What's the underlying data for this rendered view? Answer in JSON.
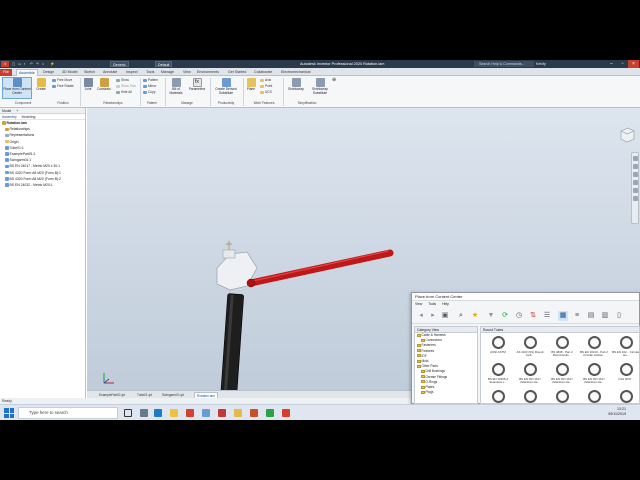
{
  "titlebar": {
    "logo": "I",
    "workspace": "Generic",
    "appearance": "Default",
    "title": "Autodesk Inventor Professional 2020   Rotation.iam",
    "search_placeholder": "Search Help & Commands...",
    "user": "Kelvfy"
  },
  "tabs": [
    "File",
    "Assemble",
    "Design",
    "3D Model",
    "Sketch",
    "Annotate",
    "Inspect",
    "Tools",
    "Manage",
    "View",
    "Environments",
    "Get Started",
    "Collaborate",
    "Electromechanical"
  ],
  "ribbon": {
    "place_label": "Place from Content Center",
    "create_label": "Create",
    "free_move": "Free Move",
    "free_rotate": "Free Rotate",
    "joint": "Joint",
    "constrain": "Constrain",
    "show": "Show",
    "show_sick": "Show Sick",
    "hide_all": "Hide All",
    "pattern": "Pattern",
    "mirror": "Mirror",
    "copy": "Copy",
    "bom": "Bill of Materials",
    "parameters": "Parameters",
    "create_substitute": "Create Derived Substitute",
    "plane": "Plane",
    "axis": "Axis",
    "point": "Point",
    "ucs": "UCS",
    "shrinkwrap": "Shrinkwrap",
    "shrinkwrap_sub": "Shrinkwrap Substitute",
    "groups": [
      "Component",
      "Position",
      "Relationships",
      "Pattern",
      "Manage",
      "Productivity",
      "Work Features",
      "Simplification"
    ]
  },
  "browser": {
    "tabs": [
      "Model",
      "+"
    ],
    "sub_tabs": [
      "Assembly",
      "Modeling"
    ],
    "root": "Rotation.iam",
    "items": [
      "Relationships",
      "Representations",
      "Origin",
      "Tube01:1",
      "ExamplePart01:1",
      "Swingarm01:1",
      "BS EN 24017 - Metric M20 x 30:1",
      "BS 4320 Form A8 M20 (Form B):1",
      "BS 4320 Form A8 M20 (Form B):2",
      "BS EN 24032 - Metric M20:1"
    ]
  },
  "doctabs": [
    "ExamplePart01.ipt",
    "Tube01.ipt",
    "Swingarm01.ipt",
    "Rotation.iam"
  ],
  "status": "Ready",
  "content_center": {
    "title": "Place from Content Center",
    "menu": [
      "View",
      "Tools",
      "Help"
    ],
    "category_header": "Category View",
    "categories": [
      "Cable & Harness",
      "Connectors",
      "Fasteners",
      "Features",
      "IDF",
      "Mold",
      "Other Parts",
      "Drill Bushings",
      "Grease Fittings",
      "O-Rings",
      "Plates",
      "Plugs"
    ],
    "grid_header": "Round Tubes",
    "parts": [
      "ANSI ASTM",
      "AS 1163 (SS) Round Holl...",
      "BS 4848 - Part 2 Round Hollo...",
      "BS EN 10210 - Part 2 Circular Hollow...",
      "BS EN 102... Circular Ho...",
      "BS EN 10305-4 Seamless c...",
      "BS EN ISO 1127 (Stainless ste...",
      "BS EN ISO 1127 (Stainless ste...",
      "BS EN ISO 1127 (Stainless ste...",
      "CSA 4037..."
    ]
  },
  "taskbar": {
    "search_placeholder": "Type here to search",
    "time": "13:21",
    "date": "09/11/2019"
  },
  "colors": {
    "arm": "#c01818",
    "tube": "#202020",
    "block": "#eef0f3",
    "accent": "#1a4f8c",
    "file_tab": "#c7402f"
  }
}
